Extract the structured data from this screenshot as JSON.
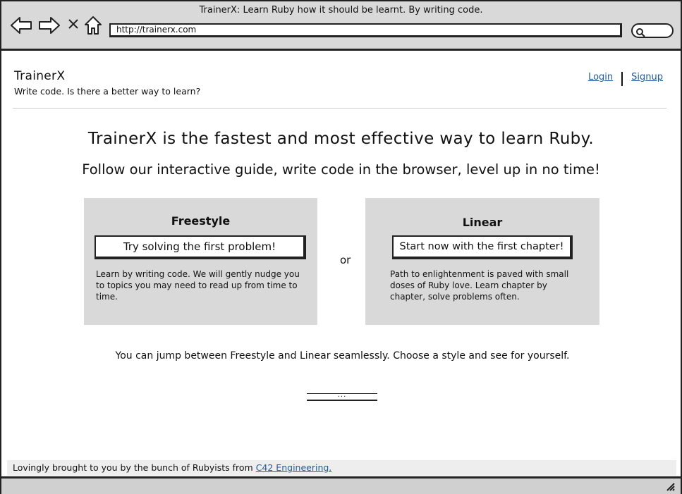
{
  "browser": {
    "window_title": "TrainerX: Learn Ruby how it should be learnt. By writing code.",
    "url": "http://trainerx.com"
  },
  "header": {
    "site_title": "TrainerX",
    "tagline": "Write code. Is there a better way to learn?",
    "login_label": "Login",
    "signup_label": "Signup"
  },
  "hero": {
    "headline": "TrainerX is the fastest and most effective way to learn Ruby.",
    "subheadline": "Follow our interactive guide, write code in the browser, level up in no time!"
  },
  "cards": {
    "freestyle": {
      "title": "Freestyle",
      "button_label": "Try solving the first problem!",
      "description": "Learn by writing code. We will gently nudge you to topics you may need to read up from time to time."
    },
    "separator": "or",
    "linear": {
      "title": "Linear",
      "button_label": "Start now with the first chapter!",
      "description": "Path to enlightenment is paved with small doses of Ruby love. Learn chapter by chapter, solve problems often."
    }
  },
  "switch_note": "You can jump between Freestyle and Linear seamlessly. Choose a style and see for yourself.",
  "pager": {
    "dots": "..."
  },
  "footer": {
    "text": "Lovingly brought to you by the bunch of Rubyists from ",
    "link_label": "C42 Engineering."
  },
  "icons": {
    "back": "back-arrow-icon",
    "forward": "forward-arrow-icon",
    "stop": "close-icon",
    "home": "home-icon",
    "search": "search-icon",
    "resize": "resize-grip-icon"
  },
  "colors": {
    "chrome_gray": "#d9d9d9",
    "card_gray": "#d9d9d9",
    "link_blue": "#1f5aa6",
    "footer_gray": "#eeeeee"
  }
}
